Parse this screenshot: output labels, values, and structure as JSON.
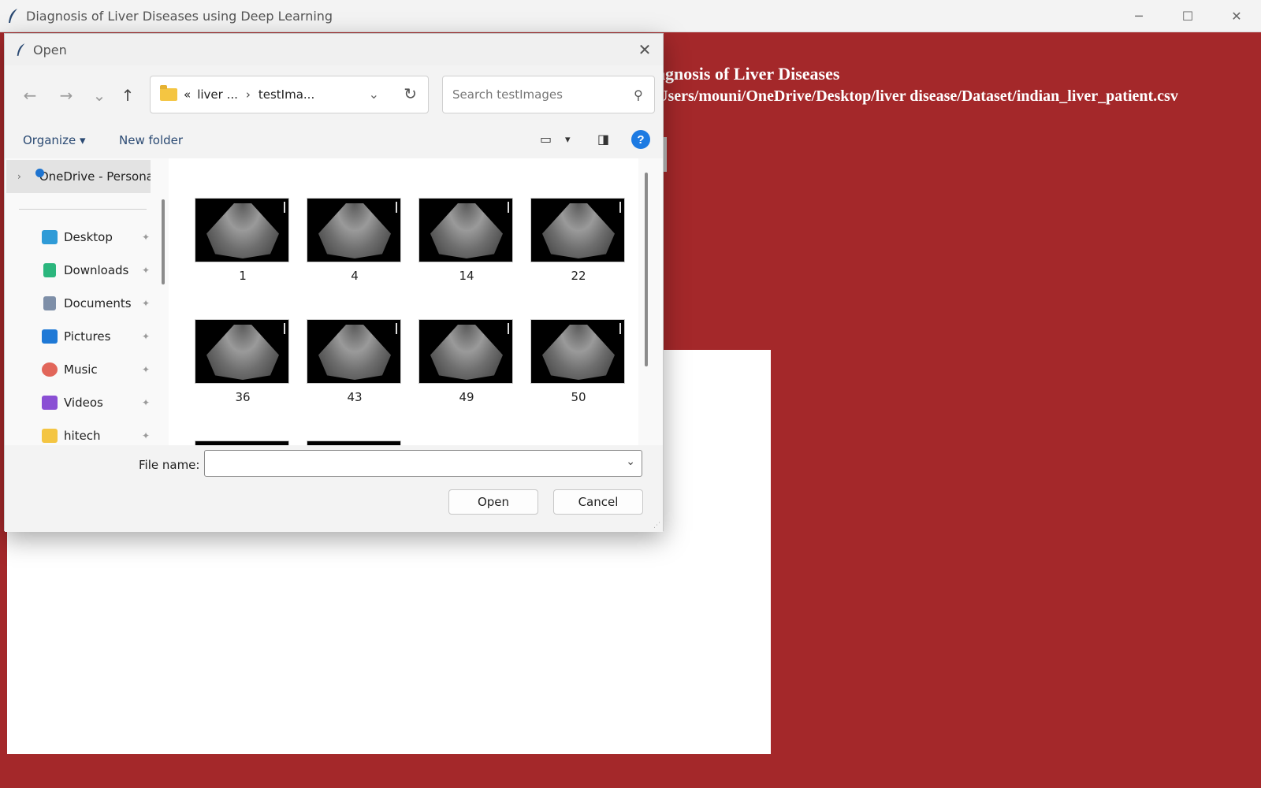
{
  "window": {
    "title": "Diagnosis of Liver Diseases using Deep Learning",
    "minimize": "─",
    "maximize": "☐",
    "close": "✕"
  },
  "app": {
    "heading": "agnosis of Liver Diseases",
    "path": "Users/mouni/OneDrive/Desktop/liver disease/Dataset/indian_liver_patient.csv",
    "background_color": "#a4282a"
  },
  "dialog": {
    "title": "Open",
    "close": "✕",
    "nav": {
      "back": "←",
      "forward": "→",
      "recent": "⌄",
      "up": "↑"
    },
    "address": {
      "chevron": "«",
      "segment1": "liver ...",
      "separator": "›",
      "segment2": "testIma...",
      "dropdown": "⌄",
      "refresh": "↻"
    },
    "search": {
      "placeholder": "Search testImages",
      "icon": "⚲"
    },
    "toolbar": {
      "organize": "Organize ▾",
      "new_folder": "New folder",
      "view_icon": "▭",
      "view_dropdown": "▾",
      "preview_icon": "◨",
      "help_icon": "?"
    },
    "nav_pane": {
      "onedrive_chevron": "›",
      "onedrive": "OneDrive - Personal",
      "pin": "✦",
      "items": [
        {
          "label": "Desktop",
          "icon": "desktop-icon",
          "color": "#2f9bd7"
        },
        {
          "label": "Downloads",
          "icon": "downloads-icon",
          "color": "#2bb67d"
        },
        {
          "label": "Documents",
          "icon": "documents-icon",
          "color": "#7e8fa8"
        },
        {
          "label": "Pictures",
          "icon": "pictures-icon",
          "color": "#1f79d6"
        },
        {
          "label": "Music",
          "icon": "music-icon",
          "color": "#e2665a"
        },
        {
          "label": "Videos",
          "icon": "videos-icon",
          "color": "#8a4fd4"
        },
        {
          "label": "hitech",
          "icon": "folder-icon",
          "color": "#f4c542"
        }
      ]
    },
    "files": [
      {
        "name": "1"
      },
      {
        "name": "4"
      },
      {
        "name": "14"
      },
      {
        "name": "22"
      },
      {
        "name": "36"
      },
      {
        "name": "43"
      },
      {
        "name": "49"
      },
      {
        "name": "50"
      },
      {
        "name": ""
      },
      {
        "name": ""
      }
    ],
    "file_name": {
      "label": "File name:",
      "value": "",
      "dropdown": "⌄"
    },
    "buttons": {
      "open": "Open",
      "cancel": "Cancel"
    },
    "grip": "⋰"
  }
}
